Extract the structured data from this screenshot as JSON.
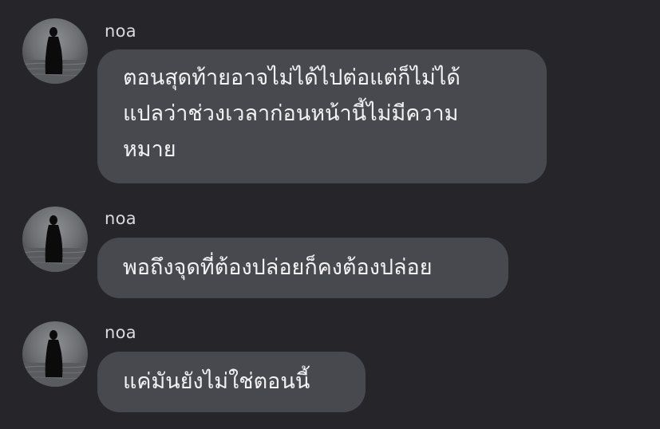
{
  "messages": [
    {
      "sender": "noa",
      "avatar_icon": "silhouette-avatar",
      "lines": [
        "ตอนสุดท้ายอาจไม่ได้ไปต่อแต่ก็ไม่ได้",
        "แปลว่าช่วงเวลาก่อนหน้านี้ไม่มีความ",
        "หมาย"
      ]
    },
    {
      "sender": "noa",
      "avatar_icon": "silhouette-avatar",
      "lines": [
        "พอถึงจุดที่ต้องปล่อยก็คงต้องปล่อย"
      ]
    },
    {
      "sender": "noa",
      "avatar_icon": "silhouette-avatar",
      "lines": [
        "แค่มันยังไม่ใช่ตอนนี้"
      ]
    }
  ],
  "colors": {
    "background": "#25252a",
    "bubble": "#48484f",
    "text": "#f2f2f4",
    "sender": "#d9d9de"
  }
}
